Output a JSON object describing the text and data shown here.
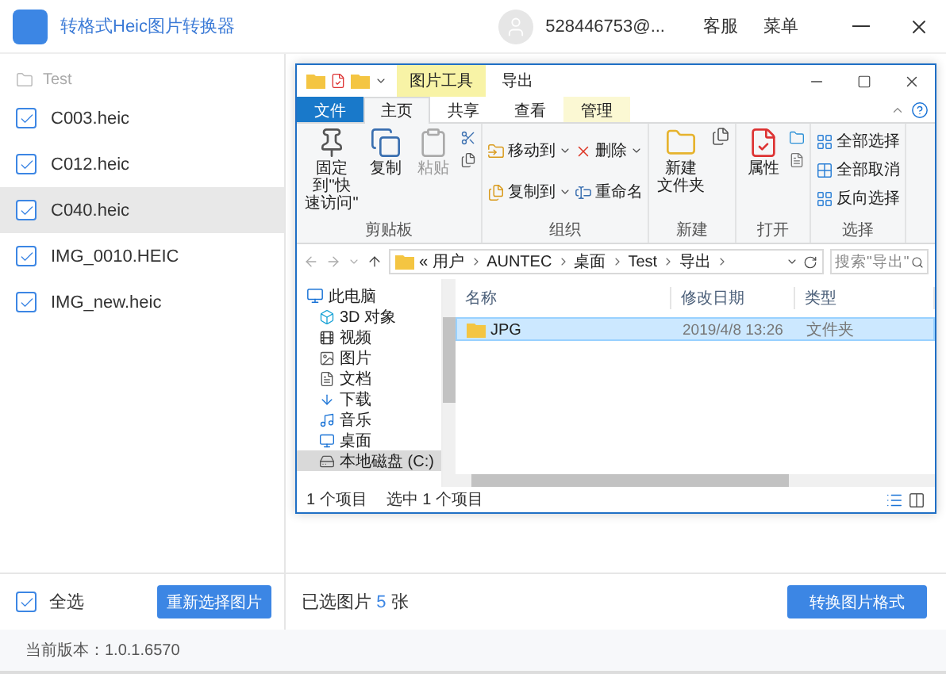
{
  "app": {
    "title": "转格式Heic图片转换器",
    "user": "528446753@...",
    "links": [
      "客服",
      "菜单"
    ]
  },
  "sidebar": {
    "folder": "Test",
    "files": [
      {
        "name": "C003.heic",
        "checked": true,
        "selected": false
      },
      {
        "name": "C012.heic",
        "checked": true,
        "selected": false
      },
      {
        "name": "C040.heic",
        "checked": true,
        "selected": true
      },
      {
        "name": "IMG_0010.HEIC",
        "checked": true,
        "selected": false
      },
      {
        "name": "IMG_new.heic",
        "checked": true,
        "selected": false
      }
    ]
  },
  "explorer": {
    "context_tab": "图片工具",
    "title": "导出",
    "tabs": [
      {
        "label": "文件",
        "selected": false,
        "kind": "file"
      },
      {
        "label": "主页",
        "selected": true,
        "kind": "tab"
      },
      {
        "label": "共享",
        "selected": false,
        "kind": "tab"
      },
      {
        "label": "查看",
        "selected": false,
        "kind": "tab"
      },
      {
        "label": "管理",
        "selected": false,
        "kind": "context"
      }
    ],
    "ribbon": [
      {
        "label": "剪贴板",
        "commands": [
          {
            "lines": [
              "固定到\"快",
              "速访问\""
            ],
            "disabled": false
          },
          {
            "lines": [
              "复制"
            ],
            "disabled": false
          },
          {
            "lines": [
              "粘贴"
            ],
            "disabled": true
          }
        ]
      },
      {
        "label": "组织",
        "commands": [
          {
            "lines": [
              "移动到"
            ],
            "disabled": false
          },
          {
            "lines": [
              "复制到"
            ],
            "disabled": false
          },
          {
            "lines": [
              "删除"
            ],
            "disabled": false
          },
          {
            "lines": [
              "重命名"
            ],
            "disabled": false
          }
        ]
      },
      {
        "label": "新建",
        "commands": [
          {
            "lines": [
              "新建",
              "文件夹"
            ],
            "disabled": false
          }
        ]
      },
      {
        "label": "打开",
        "commands": [
          {
            "lines": [
              "属性"
            ],
            "disabled": false
          }
        ]
      },
      {
        "label": "选择",
        "commands": [
          {
            "lines": [
              "全部选择"
            ],
            "disabled": false
          },
          {
            "lines": [
              "全部取消"
            ],
            "disabled": false
          },
          {
            "lines": [
              "反向选择"
            ],
            "disabled": false
          }
        ]
      }
    ],
    "path_overflow": "«",
    "path": [
      "用户",
      "AUNTEC",
      "桌面",
      "Test",
      "导出"
    ],
    "search": {
      "placeholder": "搜索\"导出\""
    },
    "nav": [
      {
        "label": "此电脑",
        "selected": false,
        "children": [
          {
            "label": "3D 对象",
            "selected": false
          },
          {
            "label": "视频",
            "selected": false
          },
          {
            "label": "图片",
            "selected": false
          },
          {
            "label": "文档",
            "selected": false
          },
          {
            "label": "下载",
            "selected": false
          },
          {
            "label": "音乐",
            "selected": false
          },
          {
            "label": "桌面",
            "selected": false
          },
          {
            "label": "本地磁盘 (C:)",
            "selected": true
          }
        ]
      }
    ],
    "columns": [
      "名称",
      "修改日期",
      "类型"
    ],
    "rows": [
      {
        "name": "JPG",
        "date": "2019/4/8 13:26",
        "type": "文件夹",
        "selected": true
      }
    ],
    "status": [
      "1 个项目",
      "选中 1 个项目"
    ]
  },
  "bottom": {
    "select_all": {
      "label": "全选",
      "checked": true
    },
    "reselect_button": "重新选择图片",
    "selected_count": {
      "prefix": "已选图片",
      "count": "5",
      "suffix": "张"
    },
    "convert_button": "转换图片格式"
  },
  "version": "当前版本：1.0.1.6570"
}
